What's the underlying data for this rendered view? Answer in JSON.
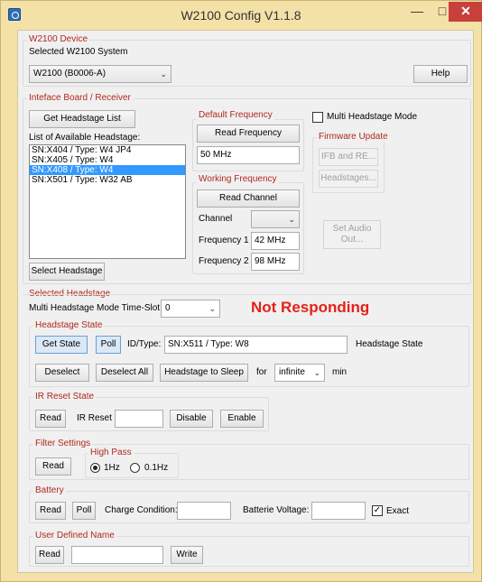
{
  "window": {
    "title": "W2100 Config V1.1.8",
    "minimize": "—",
    "maximize": "□",
    "close": "✕"
  },
  "device": {
    "group_label": "W2100 Device",
    "selected_label": "Selected W2100 System",
    "system_value": "W2100 (B0006-A)",
    "help_button": "Help"
  },
  "interface": {
    "group_label": "Inteface Board / Receiver",
    "get_list_button": "Get Headstage List",
    "list_label": "List of Available Headstage:",
    "headstages": [
      "SN:X404 / Type: W4 JP4",
      "SN:X405 / Type: W4",
      "SN:X408 / Type: W4",
      "SN:X501 / Type: W32 AB"
    ],
    "selected_index": 2,
    "select_button": "Select Headstage",
    "default_freq_label": "Default Frequency",
    "read_freq_button": "Read Frequency",
    "default_freq_value": "50 MHz",
    "working_freq_label": "Working Frequency",
    "read_channel_button": "Read Channel",
    "channel_label": "Channel",
    "channel_value": "",
    "freq1_label": "Frequency 1",
    "freq1_value": "42 MHz",
    "freq2_label": "Frequency 2",
    "freq2_value": "98 MHz",
    "multi_mode_label": "Multi Headstage Mode",
    "multi_mode_checked": false,
    "firmware_label": "Firmware Update",
    "ifb_button": "IFB and RE...",
    "headstages_button": "Headstages...",
    "set_audio_button_line1": "Set Audio",
    "set_audio_button_line2": "Out..."
  },
  "selected": {
    "group_label": "Selected Headstage",
    "timeslot_label": "Multi Headstage Mode Time-Slot:",
    "timeslot_value": "0",
    "status": "Not Responding"
  },
  "state": {
    "group_label": "Headstage State",
    "get_state_button": "Get State",
    "poll_button": "Poll",
    "id_label": "ID/Type:",
    "id_value": "SN:X511 / Type: W8",
    "state_label": "Headstage State",
    "deselect_button": "Deselect",
    "deselect_all_button": "Deselect All",
    "sleep_button": "Headstage to Sleep",
    "for_label": "for",
    "duration_value": "infinite",
    "min_label": "min"
  },
  "ir": {
    "group_label": "IR Reset State",
    "read_button": "Read",
    "ir_label": "IR Reset",
    "ir_value": "",
    "disable_button": "Disable",
    "enable_button": "Enable"
  },
  "filter": {
    "group_label": "Filter Settings",
    "read_button": "Read",
    "highpass_label": "High Pass",
    "opt1": "1Hz",
    "opt2": "0.1Hz",
    "selected": "1Hz"
  },
  "battery": {
    "group_label": "Battery",
    "read_button": "Read",
    "poll_button": "Poll",
    "charge_label": "Charge Condition:",
    "charge_value": "",
    "voltage_label": "Batterie Voltage:",
    "voltage_value": "",
    "exact_label": "Exact",
    "exact_checked": true
  },
  "user": {
    "group_label": "User Defined Name",
    "read_button": "Read",
    "name_value": "",
    "write_button": "Write"
  }
}
